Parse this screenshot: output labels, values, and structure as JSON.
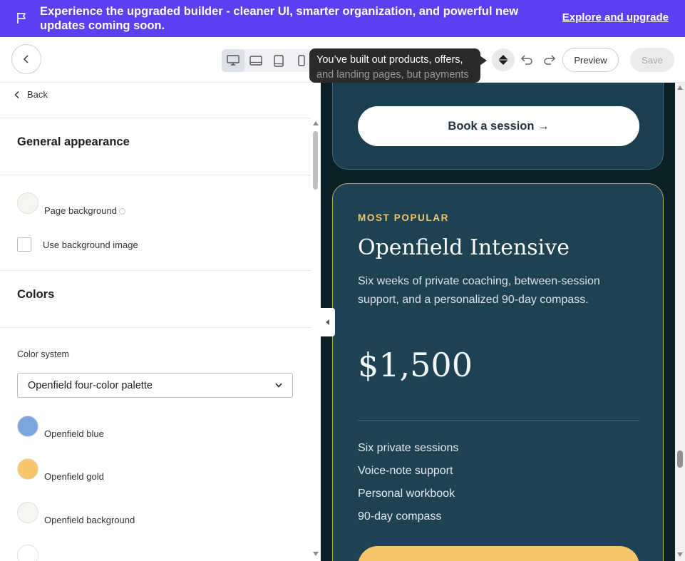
{
  "banner": {
    "message": "Experience the upgraded builder - cleaner UI, smarter organization, and powerful new updates coming soon.",
    "link": "Explore and upgrade"
  },
  "toolbar": {
    "device_icons": [
      "desktop-icon",
      "tablet-landscape-icon",
      "tablet-icon",
      "mobile-icon"
    ],
    "tooltip_line1": "You’ve built out products, offers,",
    "tooltip_line2": "and landing pages, but payments",
    "preview_label": "Preview",
    "save_label": "Save"
  },
  "sidebar": {
    "back_label": "Back",
    "general_title": "General appearance",
    "page_background_label": "Page background",
    "bg_image_label": "Use background image",
    "colors_title": "Colors",
    "color_system_label": "Color system",
    "color_system_value": "Openfield four-color palette",
    "swatches": [
      {
        "label": "Openfield blue",
        "color": "#7ba7dd"
      },
      {
        "label": "Openfield gold",
        "color": "#f5c66a"
      },
      {
        "label": "Openfield background",
        "color": "#f6f5f0"
      },
      {
        "label": "",
        "color": "#ffffff"
      }
    ],
    "page_background_color": "#f6f5f0"
  },
  "preview": {
    "book_button": "Book a session →",
    "badge": "MOST POPULAR",
    "plan_title": "Openfield Intensive",
    "plan_description": "Six weeks of private coaching, between-session support, and a personalized 90-day compass.",
    "price": "$1,500",
    "features": [
      "Six private sessions",
      "Voice-note support",
      "Personal workbook",
      "90-day compass"
    ]
  },
  "colors": {
    "banner": "#5b3ff0",
    "preview_bg": "#0d1f26",
    "card": "#1e4252",
    "gold": "#f5c66a"
  }
}
